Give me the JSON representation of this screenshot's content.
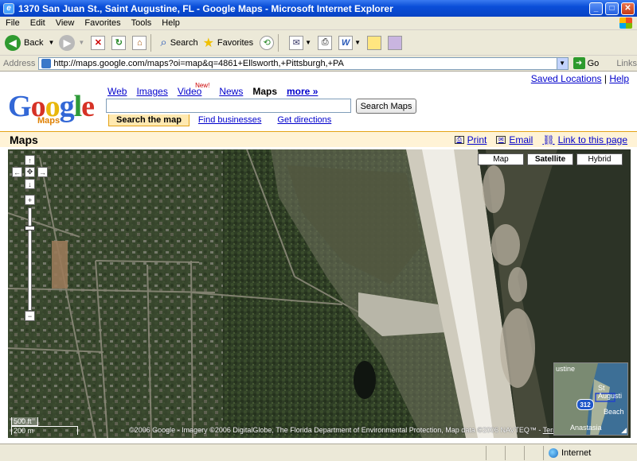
{
  "window": {
    "title": "1370 San Juan St., Saint Augustine, FL - Google Maps - Microsoft Internet Explorer",
    "minimize": "_",
    "maximize": "□",
    "close": "✕"
  },
  "menu": [
    "File",
    "Edit",
    "View",
    "Favorites",
    "Tools",
    "Help"
  ],
  "toolbar": {
    "back": "Back",
    "search": "Search",
    "favorites": "Favorites"
  },
  "address": {
    "label": "Address",
    "url": "http://maps.google.com/maps?oi=map&q=4861+Ellsworth,+Pittsburgh,+PA",
    "go": "Go",
    "links": "Links"
  },
  "page": {
    "saved_locations": "Saved Locations",
    "separator": "|",
    "help": "Help",
    "logo_sub": "Maps",
    "nav": {
      "web": "Web",
      "images": "Images",
      "video": "Video",
      "video_badge": "New!",
      "news": "News",
      "maps": "Maps",
      "more": "more »"
    },
    "search_value": "",
    "search_button": "Search Maps",
    "tabs": {
      "search_map": "Search the map",
      "find_businesses": "Find businesses",
      "get_directions": "Get directions"
    },
    "maps_title": "Maps",
    "print": "Print",
    "email": "Email",
    "link": "Link to this page"
  },
  "map": {
    "types": {
      "map": "Map",
      "satellite": "Satellite",
      "hybrid": "Hybrid"
    },
    "selected_type": "Satellite",
    "scale_top": "500 ft",
    "scale_bottom": "200 m",
    "copyright": "©2006 Google - Imagery ©2006 DigitalGlobe, The Florida Department of Environmental Protection, Map data ©2006 NAVTEQ™ - ",
    "terms": "Terms of Use",
    "overview": {
      "top_label": "ustine",
      "right_label": "St Augusti",
      "beach_label": "Beach",
      "bottom_label": "Anastasia",
      "shield": "312"
    }
  },
  "status": {
    "text": "",
    "zone": "Internet"
  }
}
